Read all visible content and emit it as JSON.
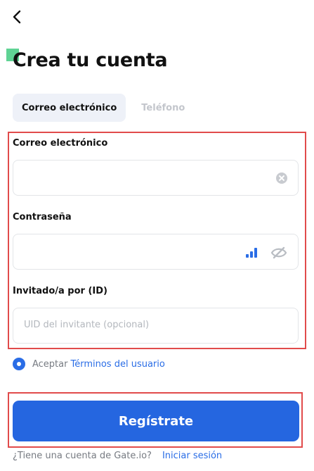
{
  "header": {
    "title": "Crea tu cuenta"
  },
  "tabs": [
    {
      "label": "Correo electrónico",
      "active": true
    },
    {
      "label": "Teléfono",
      "active": false
    }
  ],
  "form": {
    "email_label": "Correo electrónico",
    "email_value": "",
    "password_label": "Contraseña",
    "password_value": "",
    "referral_label": "Invitado/a por (ID)",
    "referral_placeholder": "UID del invitante (opcional)"
  },
  "agreement": {
    "text": "Aceptar",
    "link": "Términos del usuario",
    "checked": true
  },
  "register_button": "Regístrate",
  "login": {
    "question": "¿Tiene una cuenta de Gate.io?",
    "link": "Iniciar sesión"
  },
  "icons": [
    "back-arrow-icon",
    "clear-icon",
    "strength-icon",
    "eye-hidden-icon",
    "radio-checked-icon"
  ],
  "colors": {
    "accent": "#2566e0",
    "brand_green": "#5fd394",
    "highlight_border": "#e14b4b"
  }
}
